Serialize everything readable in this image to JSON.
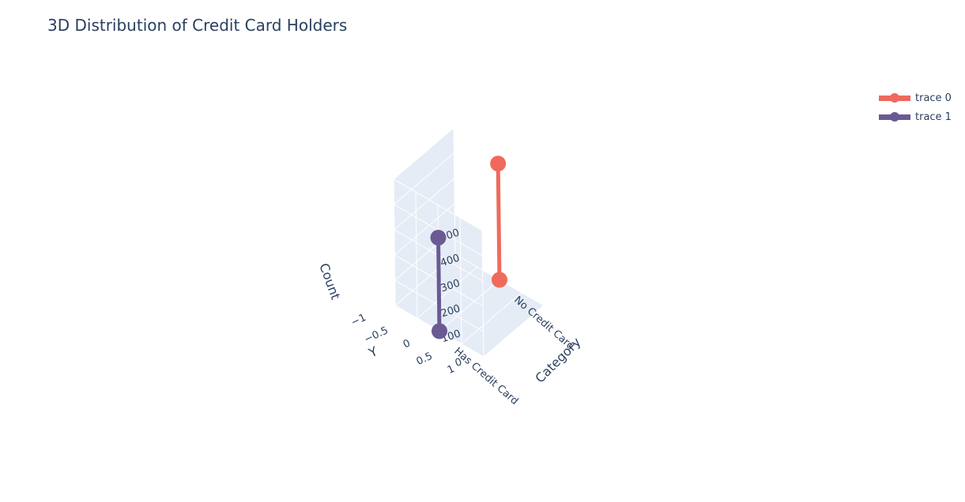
{
  "title": "3D Distribution of Credit Card Holders",
  "legend": [
    {
      "name": "trace 0",
      "color": "#ef6a5c"
    },
    {
      "name": "trace 1",
      "color": "#6a5a94"
    }
  ],
  "chart_data": {
    "type": "scatter3d",
    "title": "3D Distribution of Credit Card Holders",
    "x_axis": {
      "label": "Category",
      "ticks": [
        "Has Credit Card",
        "No Credit Card"
      ]
    },
    "y_axis": {
      "label": "Y",
      "ticks": [
        "−1",
        "−0.5",
        "0",
        "0.5",
        "1"
      ],
      "range": [
        -1,
        1
      ]
    },
    "z_axis": {
      "label": "Count",
      "ticks": [
        "0",
        "100",
        "200",
        "300",
        "400",
        "500"
      ],
      "range": [
        0,
        500
      ]
    },
    "series": [
      {
        "name": "trace 0",
        "color": "#ef6a5c",
        "mode": "lines+markers",
        "points": [
          {
            "x": "No Credit Card",
            "y": 0,
            "z": 0
          },
          {
            "x": "No Credit Card",
            "y": 0,
            "z": 460
          }
        ]
      },
      {
        "name": "trace 1",
        "color": "#6a5a94",
        "mode": "lines+markers",
        "points": [
          {
            "x": "Has Credit Card",
            "y": 0,
            "z": 0
          },
          {
            "x": "Has Credit Card",
            "y": 0,
            "z": 370
          }
        ]
      }
    ]
  }
}
